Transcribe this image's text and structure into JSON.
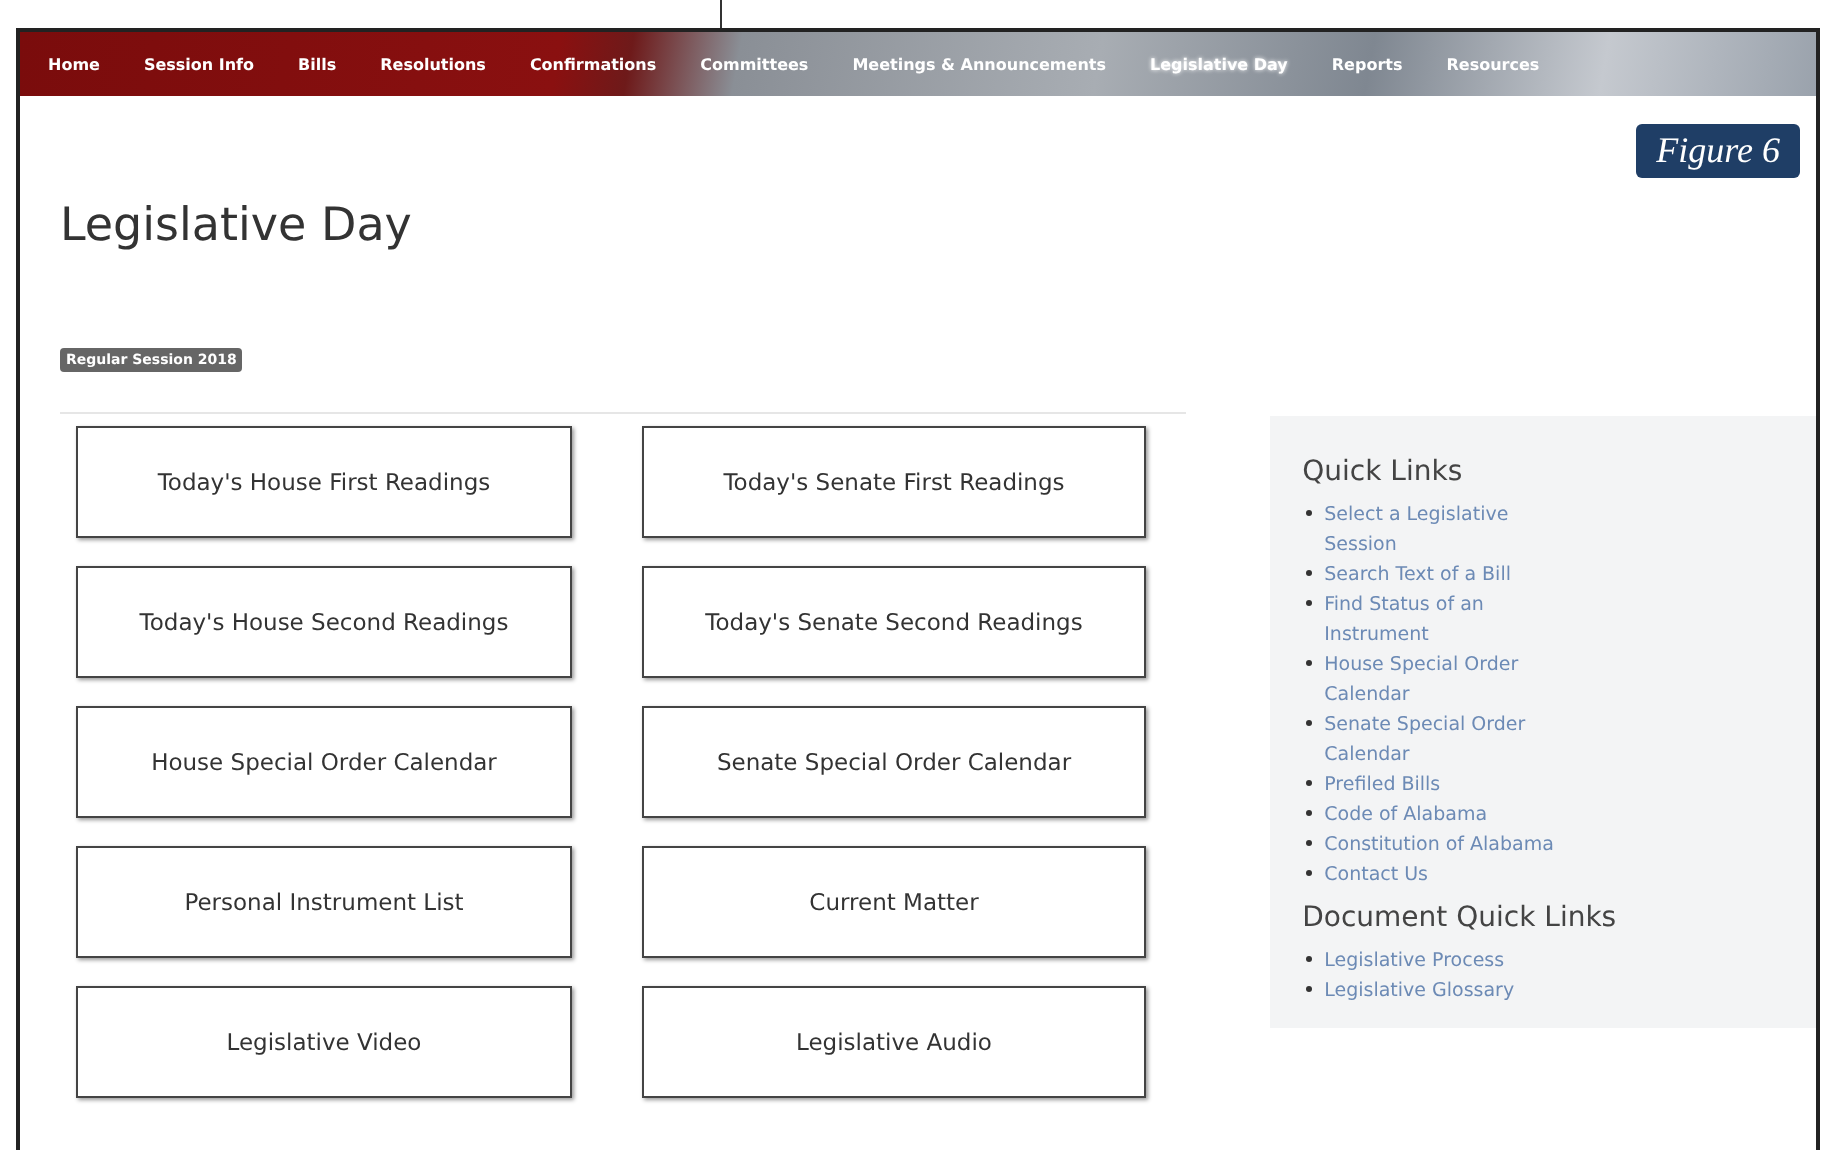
{
  "nav": [
    {
      "label": "Home",
      "selected": false
    },
    {
      "label": "Session Info",
      "selected": false
    },
    {
      "label": "Bills",
      "selected": false
    },
    {
      "label": "Resolutions",
      "selected": false
    },
    {
      "label": "Confirmations",
      "selected": false
    },
    {
      "label": "Committees",
      "selected": false
    },
    {
      "label": "Meetings & Announcements",
      "selected": false
    },
    {
      "label": "Legislative Day",
      "selected": true
    },
    {
      "label": "Reports",
      "selected": false
    },
    {
      "label": "Resources",
      "selected": false
    }
  ],
  "figure_label": "Figure 6",
  "title": "Legislative Day",
  "session_badge": "Regular Session 2018",
  "buttons": [
    "Today's House First Readings",
    "Today's Senate First Readings",
    "Today's House Second Readings",
    "Today's Senate Second Readings",
    "House Special Order Calendar",
    "Senate Special Order Calendar",
    "Personal Instrument List",
    "Current Matter",
    "Legislative Video",
    "Legislative Audio"
  ],
  "sidebar": [
    {
      "heading": "Quick Links",
      "links": [
        "Select a Legislative Session",
        "Search Text of a Bill",
        "Find Status of an Instrument",
        "House Special Order Calendar",
        "Senate Special Order Calendar",
        "Prefiled Bills",
        "Code of Alabama",
        "Constitution of Alabama",
        "Contact Us"
      ]
    },
    {
      "heading": "Document Quick Links",
      "links": [
        "Legislative Process",
        "Legislative Glossary"
      ]
    }
  ]
}
